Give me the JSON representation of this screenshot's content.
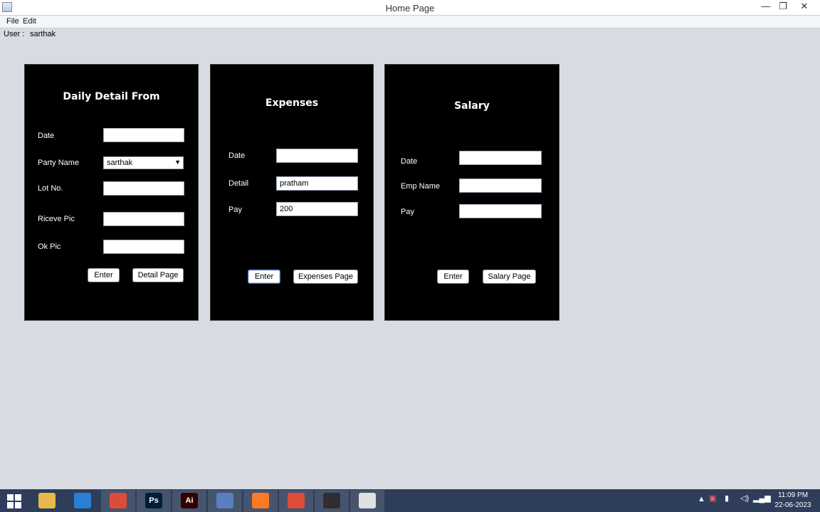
{
  "window": {
    "title": "Home Page",
    "minimize": "—",
    "maximize": "❐",
    "close": "✕"
  },
  "menu": {
    "file": "File",
    "edit": "Edit"
  },
  "user": {
    "label": "User :",
    "name": "sarthak"
  },
  "daily": {
    "title": "Daily Detail From",
    "date_label": "Date",
    "date_value": "",
    "party_label": "Party Name",
    "party_value": "sarthak",
    "lot_label": "Lot No.",
    "lot_value": "",
    "receive_label": "Riceve  Pic",
    "receive_value": "",
    "ok_label": "Ok Pic",
    "ok_value": "",
    "enter_btn": "Enter",
    "page_btn": "Detail Page"
  },
  "expenses": {
    "title": "Expenses",
    "date_label": "Date",
    "date_value": "",
    "detail_label": "Detail",
    "detail_value": "pratham",
    "pay_label": "Pay",
    "pay_value": "200",
    "enter_btn": "Enter",
    "page_btn": "Expenses Page"
  },
  "salary": {
    "title": "Salary",
    "date_label": "Date",
    "date_value": "",
    "emp_label": "Emp Name",
    "emp_value": "",
    "pay_label": "Pay",
    "pay_value": "",
    "enter_btn": "Enter",
    "page_btn": "Salary Page"
  },
  "taskbar": {
    "apps": [
      {
        "name": "file-explorer",
        "text": "",
        "color": "#e8b84a"
      },
      {
        "name": "vscode",
        "text": "",
        "color": "#2b7fd4"
      },
      {
        "name": "chrome",
        "text": "",
        "color": "#dd4b39"
      },
      {
        "name": "photoshop",
        "text": "Ps",
        "color": "#001e36"
      },
      {
        "name": "illustrator",
        "text": "Ai",
        "color": "#330000"
      },
      {
        "name": "virtualbox",
        "text": "",
        "color": "#5a7fbf"
      },
      {
        "name": "xampp",
        "text": "",
        "color": "#fb7a24"
      },
      {
        "name": "chrome-2",
        "text": "",
        "color": "#dd4b39"
      },
      {
        "name": "obs",
        "text": "",
        "color": "#302e31"
      },
      {
        "name": "java",
        "text": "",
        "color": "#e0e0e0"
      }
    ],
    "time": "11:09 PM",
    "date": "22-06-2023"
  }
}
